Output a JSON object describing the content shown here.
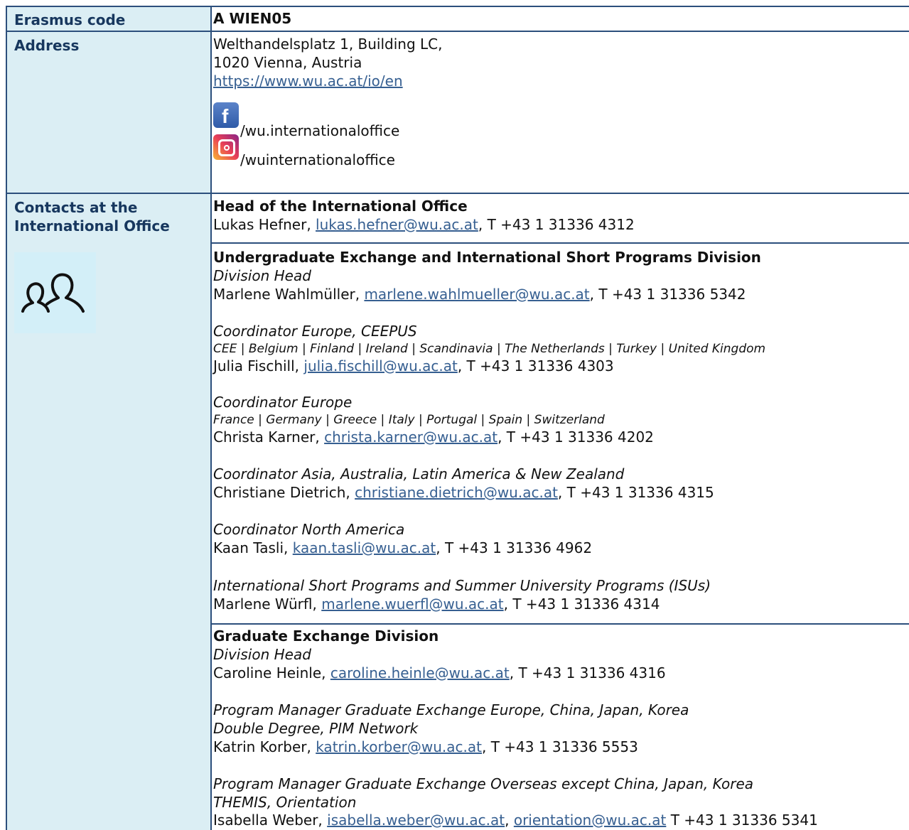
{
  "labels": {
    "erasmus": "Erasmus code",
    "address": "Address",
    "contacts_1": "Contacts at the",
    "contacts_2": "International Office"
  },
  "erasmus_code": "A WIEN05",
  "address": {
    "line1": "Welthandelsplatz 1, Building LC,",
    "line2": "1020 Vienna, Austria",
    "website": "https://www.wu.ac.at/io/en",
    "facebook": "/wu.internationaloffice",
    "instagram": "/wuinternationaloffice"
  },
  "head": {
    "title": "Head of the International Office",
    "name": "Lukas Hefner, ",
    "email": "lukas.hefner@wu.ac.at",
    "phone": ", T +43 1 31336 4312"
  },
  "undergrad": {
    "title": "Undergraduate Exchange and International Short Programs Division",
    "division_head_role": "Division Head",
    "division_head_name": "Marlene Wahlmüller, ",
    "division_head_email": "marlene.wahlmueller@wu.ac.at",
    "division_head_phone": ", T +43 1 31336 5342",
    "c1_role": "Coordinator Europe, CEEPUS",
    "c1_regions": "CEE | Belgium | Finland | Ireland | Scandinavia | The Netherlands | Turkey | United Kingdom",
    "c1_name": "Julia Fischill, ",
    "c1_email": "julia.fischill@wu.ac.at",
    "c1_phone": ", T +43 1 31336 4303",
    "c2_role": "Coordinator Europe",
    "c2_regions": "France | Germany | Greece | Italy | Portugal | Spain | Switzerland",
    "c2_name": "Christa Karner, ",
    "c2_email": "christa.karner@wu.ac.at",
    "c2_phone": ", T +43 1 31336 4202",
    "c3_role": "Coordinator Asia, Australia, Latin America & New Zealand",
    "c3_name": "Christiane Dietrich, ",
    "c3_email": "christiane.dietrich@wu.ac.at",
    "c3_phone": ", T +43 1 31336 4315",
    "c4_role": "Coordinator North America",
    "c4_name": "Kaan Tasli, ",
    "c4_email": "kaan.tasli@wu.ac.at",
    "c4_phone": ", T +43 1 31336 4962",
    "c5_role": "International Short Programs and Summer University Programs (ISUs)",
    "c5_name": "Marlene Würfl, ",
    "c5_email": "marlene.wuerfl@wu.ac.at",
    "c5_phone": ", T +43 1 31336 4314"
  },
  "graduate": {
    "title": "Graduate Exchange Division",
    "division_head_role": "Division Head",
    "division_head_name": "Caroline Heinle, ",
    "division_head_email": "caroline.heinle@wu.ac.at",
    "division_head_phone": ", T +43 1 31336 4316",
    "p1_role1": "Program Manager Graduate Exchange Europe, China, Japan, Korea",
    "p1_role2": "Double Degree, PIM Network",
    "p1_name": "Katrin Korber, ",
    "p1_email": "katrin.korber@wu.ac.at",
    "p1_phone": ",  T +43 1 31336 5553",
    "p2_role1": "Program Manager Graduate Exchange Overseas except China, Japan, Korea",
    "p2_role2": "THEMIS, Orientation",
    "p2_name": "Isabella Weber, ",
    "p2_email1": "isabella.weber@wu.ac.at",
    "p2_sep": ", ",
    "p2_email2": "orientation@wu.ac.at",
    "p2_phone": " T +43 1 31336 5341"
  }
}
